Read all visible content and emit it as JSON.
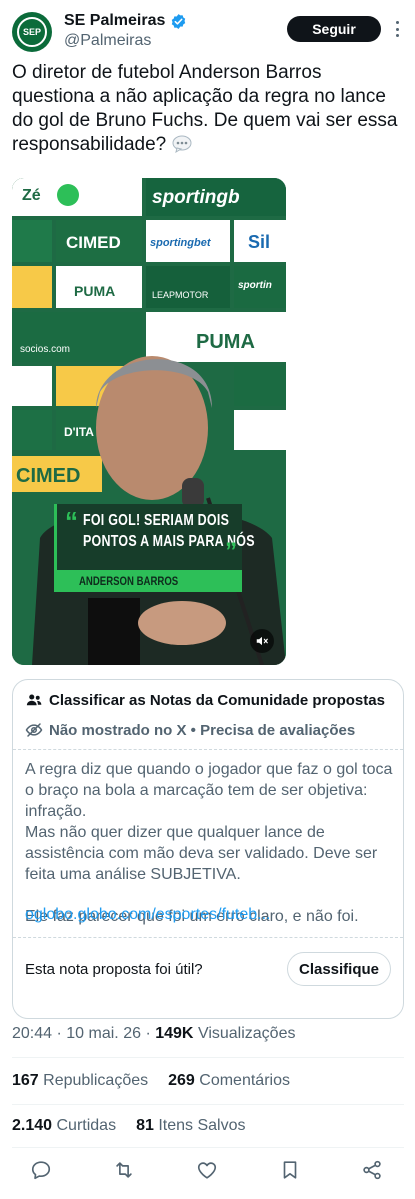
{
  "account": {
    "display_name": "SE Palmeiras",
    "handle": "@Palmeiras",
    "avatar_label": "SEP",
    "follow_label": "Seguir"
  },
  "tweet": {
    "text": "O diretor de futebol Anderson Barros questiona a não aplicação da regra no lance do gol de Bruno Fuchs. De quem vai ser essa responsabilidade?"
  },
  "media": {
    "backdrop_text": [
      "sportingb",
      "CIMED",
      "sportingbet",
      "Sil",
      "PUMA",
      "LEAPMOTOR",
      "sportin",
      "socios.com",
      "PUMA",
      "D'ITA",
      "CIMED"
    ],
    "quote_lines": [
      "FOI GOL! SERIAM DOIS",
      "PONTOS A MAIS PARA NÓS"
    ],
    "quote_author": "ANDERSON BARROS"
  },
  "community_note": {
    "title": "Classificar as Notas da Comunidade propostas",
    "status": "Não mostrado no X • Precisa de avaliações",
    "body": [
      "A regra diz que quando o jogador que faz o gol toca o braço na bola a marcação tem de ser objetiva: infração.",
      "Mas não quer dizer que qualquer lance de assistência com mão deva ser validado. Deve ser feita uma análise SUBJETIVA.",
      "",
      "Ele faz parecer que foi um erro claro, e não foi."
    ],
    "link": "oglobo.globo.com/esportes/futeb...",
    "question": "Esta nota proposta foi útil?",
    "rate_label": "Classifique"
  },
  "meta": {
    "time": "20:44",
    "date": "10 mai. 26",
    "views_count": "149K",
    "views_label": "Visualizações"
  },
  "stats": {
    "reposts_count": "167",
    "reposts_label": "Republicações",
    "comments_count": "269",
    "comments_label": "Comentários",
    "likes_count": "2.140",
    "likes_label": "Curtidas",
    "bookmarks_count": "81",
    "bookmarks_label": "Itens Salvos"
  },
  "colors": {
    "accent": "#1d9bf0",
    "verified": "#1d9bf0",
    "text": "#0f1419",
    "muted": "#536471",
    "club_green": "#0b6b3a"
  },
  "icons": [
    "verified-badge-icon",
    "more-icon",
    "chat-bubble-icon",
    "mute-icon",
    "people-icon",
    "eye-off-icon",
    "reply-icon",
    "repost-icon",
    "like-icon",
    "bookmark-icon",
    "share-icon"
  ]
}
